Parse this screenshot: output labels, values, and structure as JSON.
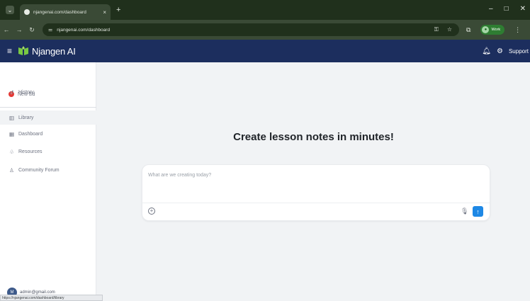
{
  "browser": {
    "tab_title": "njangenai.com/dashboard",
    "tab_close": "×",
    "new_tab": "+",
    "url": "njangenai.com/dashboard",
    "profile_label": "Work",
    "window_controls": [
      "–",
      "□",
      "✕"
    ]
  },
  "app": {
    "brand": "Njangen AI",
    "header_right": {
      "support_label": "Support"
    }
  },
  "sidebar": {
    "items": [
      {
        "label": "New Ed",
        "icon": "new-icon"
      },
      {
        "label": "History",
        "icon": "history-icon"
      },
      {
        "label": "Library",
        "icon": "library-icon"
      },
      {
        "label": "Dashboard",
        "icon": "dashboard-icon"
      },
      {
        "label": "Resources",
        "icon": "resources-icon"
      },
      {
        "label": "Community Forum",
        "icon": "community-icon"
      }
    ],
    "user_email": "admin@gmail.com",
    "user_initial": "M"
  },
  "main": {
    "headline": "Create lesson notes in minutes!",
    "composer_placeholder": "What are we creating today?"
  },
  "statusbar": {
    "text": "https://njangenai.com/dashboard/library"
  },
  "colors": {
    "header_bg": "#1c2e5e",
    "send_button": "#1e88e5",
    "new_icon": "#e53935"
  }
}
